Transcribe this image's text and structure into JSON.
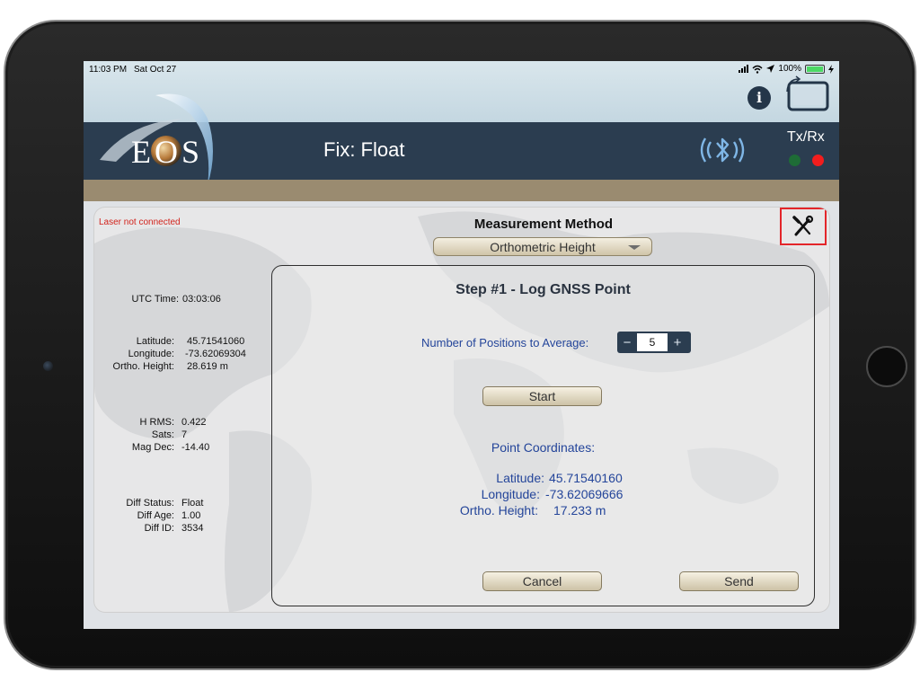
{
  "status_bar": {
    "time": "11:03 PM",
    "date": "Sat Oct 27",
    "battery": "100%"
  },
  "header": {
    "logo_text": "EOS",
    "fix_status": "Fix: Float",
    "txrx_label": "Tx/Rx",
    "tx_color": "#1e6c36",
    "rx_color": "#f21d1d"
  },
  "panel": {
    "laser_status": "Laser not connected",
    "method_title": "Measurement Method",
    "method_value": "Orthometric Height"
  },
  "readouts": {
    "utc_label": "UTC Time:",
    "utc_value": "03:03:06",
    "latitude_label": "Latitude:",
    "latitude_value": "45.71541060",
    "longitude_label": "Longitude:",
    "longitude_value": "-73.62069304",
    "ortho_label": "Ortho. Height:",
    "ortho_value": "28.619 m",
    "hrms_label": "H RMS:",
    "hrms_value": "0.422",
    "sats_label": "Sats:",
    "sats_value": "7",
    "magdec_label": "Mag Dec:",
    "magdec_value": "-14.40",
    "diff_status_label": "Diff Status:",
    "diff_status_value": "Float",
    "diff_age_label": "Diff Age:",
    "diff_age_value": "1.00",
    "diff_id_label": "Diff ID:",
    "diff_id_value": "3534"
  },
  "step": {
    "title": "Step #1 - Log GNSS Point",
    "avg_label": "Number of Positions to Average:",
    "avg_minus": "−",
    "avg_value": "5",
    "avg_plus": "+",
    "start_label": "Start",
    "coords_title": "Point Coordinates:",
    "latitude_label": "Latitude:",
    "latitude_value": "45.71540160",
    "longitude_label": "Longitude:",
    "longitude_value": "-73.62069666",
    "ortho_label": "Ortho. Height:",
    "ortho_value": "17.233 m",
    "cancel_label": "Cancel",
    "send_label": "Send"
  },
  "icons": {
    "info": "info-icon",
    "rotate": "rotate-device-icon",
    "bluetooth": "bluetooth-icon",
    "tools": "tools-icon"
  }
}
